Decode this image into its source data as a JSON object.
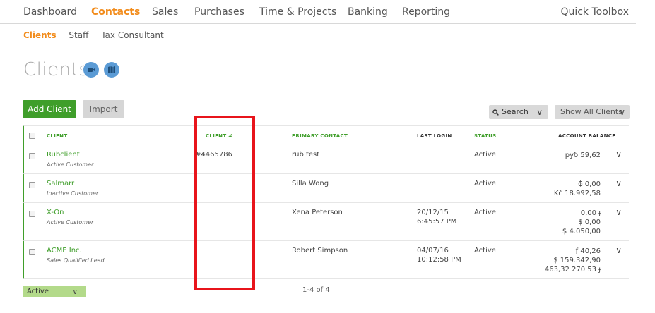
{
  "topnav": {
    "items": [
      "Dashboard",
      "Contacts",
      "Sales",
      "Purchases",
      "Time & Projects",
      "Banking",
      "Reporting"
    ],
    "active": "Contacts",
    "toolbox": "Quick Toolbox"
  },
  "subnav": {
    "items": [
      "Clients",
      "Staff",
      "Tax Consultant"
    ],
    "active": "Clients"
  },
  "page": {
    "title": "Clients",
    "icons": [
      "video-camera-icon",
      "map-icon"
    ]
  },
  "toolbar": {
    "add_label": "Add Client",
    "import_label": "Import",
    "search_label": "Search",
    "filter_label": "Show All Clients"
  },
  "table": {
    "headers": {
      "client": "CLIENT",
      "client_no": "CLIENT #",
      "primary_contact": "PRIMARY CONTACT",
      "last_login": "LAST LOGIN",
      "status": "STATUS",
      "balance": "ACCOUNT BALANCE"
    },
    "rows": [
      {
        "name": "Rubclient",
        "type": "Active Customer",
        "client_no": "#4465786",
        "contact": "rub test",
        "login_date": "",
        "login_time": "",
        "status": "Active",
        "balance": [
          "руб 59,62"
        ]
      },
      {
        "name": "Salmarr",
        "type": "Inactive Customer",
        "client_no": "",
        "contact": "Silla Wong",
        "login_date": "",
        "login_time": "",
        "status": "Active",
        "balance": [
          "₲ 0,00",
          "Kč 18.992,58"
        ]
      },
      {
        "name": "X-On",
        "type": "Active Customer",
        "client_no": "",
        "contact": "Xena Peterson",
        "login_date": "20/12/15",
        "login_time": "6:45:57 PM",
        "status": "Active",
        "balance": [
          "0,00 ɟ",
          "$ 0,00",
          "$ 4.050,00"
        ]
      },
      {
        "name": "ACME Inc.",
        "type": "Sales Qualified Lead",
        "client_no": "",
        "contact": "Robert Simpson",
        "login_date": "04/07/16",
        "login_time": "10:12:58 PM",
        "status": "Active",
        "balance": [
          "ƒ 40,26",
          "$ 159.342,90",
          "463,32 270 53 ɟ"
        ]
      }
    ]
  },
  "footer": {
    "status_filter": "Active",
    "pager": "1-4 of 4"
  },
  "colors": {
    "accent_orange": "#f28c1c",
    "accent_green": "#3f9e2a",
    "highlight_red": "#e8141b",
    "icon_blue": "#5b9bd5"
  }
}
